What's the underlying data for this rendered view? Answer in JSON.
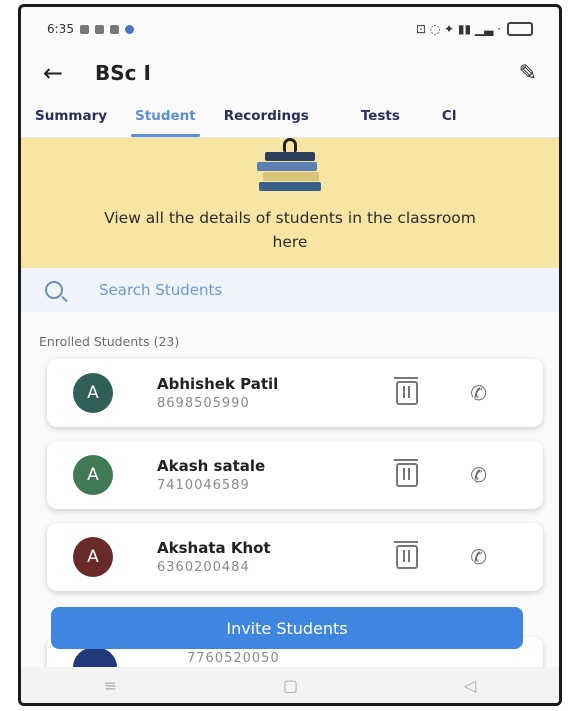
{
  "status_bar": {
    "time": "6:35",
    "right_icons": "⊡ ◌ ✦ ▮▮ ▁▃ ·"
  },
  "header": {
    "title": "BSc I"
  },
  "tabs": [
    {
      "label": "Summary"
    },
    {
      "label": "Student",
      "active": true
    },
    {
      "label": "Recordings"
    },
    {
      "label": "Tests"
    },
    {
      "label": "Cl"
    }
  ],
  "banner": {
    "text": "View all the details of students in the classroom here"
  },
  "search": {
    "placeholder": "Search Students"
  },
  "enrolled_label": "Enrolled Students (23)",
  "students": [
    {
      "initial": "A",
      "name": "Abhishek Patil",
      "phone": "8698505990",
      "avatar_color": "#2f5f57"
    },
    {
      "initial": "A",
      "name": "Akash satale",
      "phone": "7410046589",
      "avatar_color": "#3f7a55"
    },
    {
      "initial": "A",
      "name": "Akshata Khot",
      "phone": "6360200484",
      "avatar_color": "#6a2a2a"
    }
  ],
  "partial_student": {
    "phone": "7760520050"
  },
  "invite_button": {
    "label": "Invite Students"
  },
  "nav": {
    "menu": "≡",
    "home": "▢",
    "back": "◁"
  },
  "colors": {
    "accent": "#5b8fd6",
    "button": "#3f86e0",
    "banner": "#f7e6a3"
  }
}
